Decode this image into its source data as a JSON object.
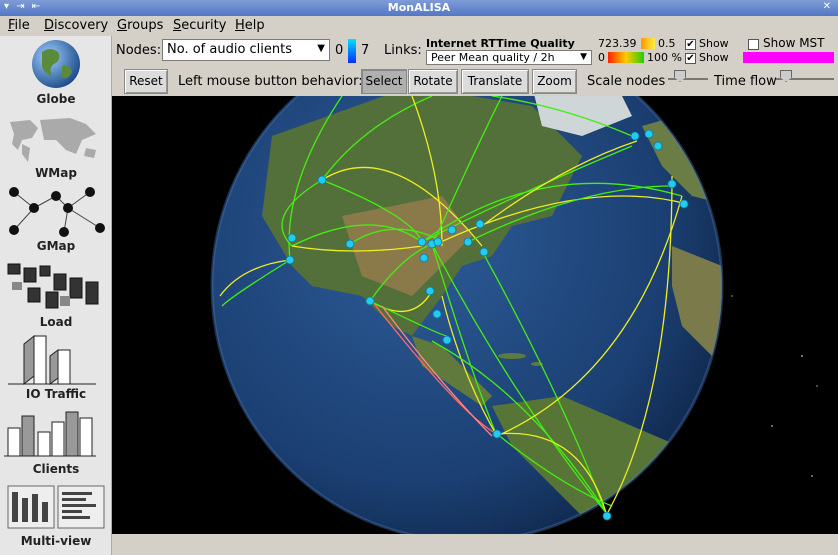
{
  "window": {
    "title": "MonALISA",
    "left_controls": "▾ ⇥ ⇤",
    "right_controls": "✕"
  },
  "menu": {
    "file": "File",
    "discovery": "Discovery",
    "groups": "Groups",
    "security": "Security",
    "help": "Help"
  },
  "sidebar": {
    "globe": "Globe",
    "wmap": "WMap",
    "gmap": "GMap",
    "load": "Load",
    "io_traffic": "IO Traffic",
    "clients": "Clients",
    "multi_view": "Multi-view"
  },
  "nodes": {
    "label": "Nodes:",
    "selected": "No. of audio clients",
    "min": "0",
    "max": "7"
  },
  "links": {
    "label": "Links:",
    "title": "Internet RTTime Quality",
    "selected": "Peer Mean quality / 2h",
    "rt_value": "723.39",
    "rt_min": "0.5",
    "q_min": "0",
    "q_max": "100 %",
    "show1": "Show",
    "show2": "Show",
    "show1_checked": "✔",
    "show2_checked": "✔",
    "mst": "Show MST",
    "mst_color": "#ff00ff"
  },
  "toolbar": {
    "reset": "Reset",
    "mouse_label": "Left mouse button behavior:",
    "select": "Select",
    "rotate": "Rotate",
    "translate": "Translate",
    "zoom": "Zoom",
    "scale_nodes": "Scale nodes",
    "time_flow": "Time flow"
  },
  "colors": {
    "ocean": "#1c3f77",
    "land_green": "#4f6b2f",
    "link_green": "#44ee11",
    "link_yellow": "#eeee22",
    "node": "#22ccee"
  }
}
